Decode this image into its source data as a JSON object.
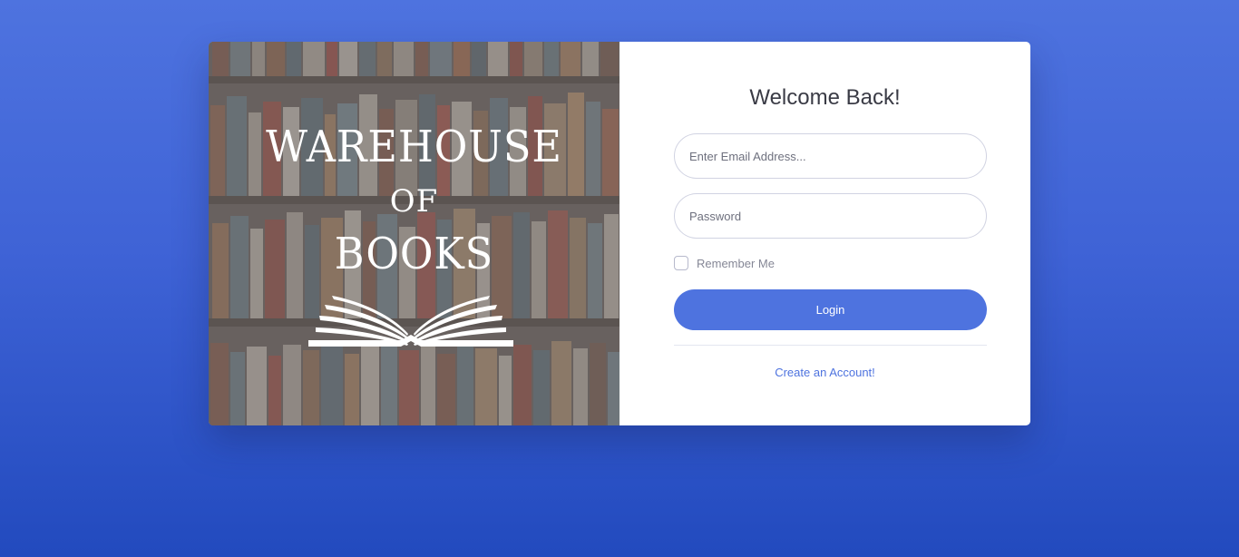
{
  "brand": {
    "line1": "WAREHOUSE",
    "line2": "OF",
    "line3": "BOOKS"
  },
  "login": {
    "heading": "Welcome Back!",
    "email_placeholder": "Enter Email Address...",
    "password_placeholder": "Password",
    "remember_label": "Remember Me",
    "login_label": "Login",
    "create_account_label": "Create an Account!"
  },
  "colors": {
    "primary": "#4e73df",
    "background_top": "#4e73df",
    "background_bottom": "#224abe"
  }
}
